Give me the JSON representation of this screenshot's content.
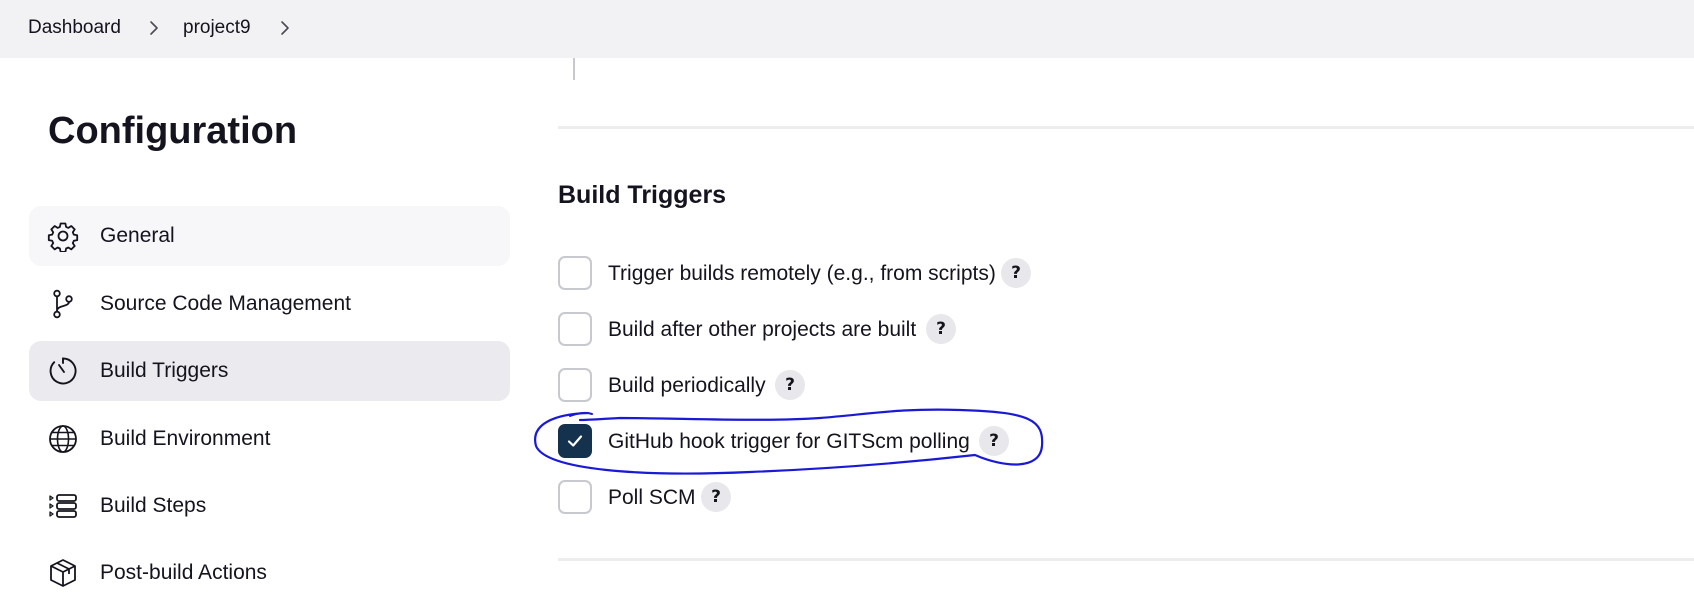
{
  "breadcrumb": {
    "items": [
      "Dashboard",
      "project9"
    ]
  },
  "page": {
    "title": "Configuration"
  },
  "sidebar": {
    "items": [
      {
        "label": "General",
        "icon": "gear-icon"
      },
      {
        "label": "Source Code Management",
        "icon": "git-branch-icon"
      },
      {
        "label": "Build Triggers",
        "icon": "stopwatch-icon",
        "active": true
      },
      {
        "label": "Build Environment",
        "icon": "globe-icon"
      },
      {
        "label": "Build Steps",
        "icon": "list-steps-icon"
      },
      {
        "label": "Post-build Actions",
        "icon": "package-icon"
      }
    ]
  },
  "build_triggers": {
    "title": "Build Triggers",
    "options": [
      {
        "label": "Trigger builds remotely (e.g., from scripts)",
        "checked": false,
        "help": "?"
      },
      {
        "label": "Build after other projects are built",
        "checked": false,
        "help": "?"
      },
      {
        "label": "Build periodically",
        "checked": false,
        "help": "?"
      },
      {
        "label": "GitHub hook trigger for GITScm polling",
        "checked": true,
        "help": "?"
      },
      {
        "label": "Poll SCM",
        "checked": false,
        "help": "?"
      }
    ]
  },
  "colors": {
    "checkbox_checked": "#14324d",
    "annotation": "#1a1ad6",
    "active_nav": "#ebebef"
  }
}
